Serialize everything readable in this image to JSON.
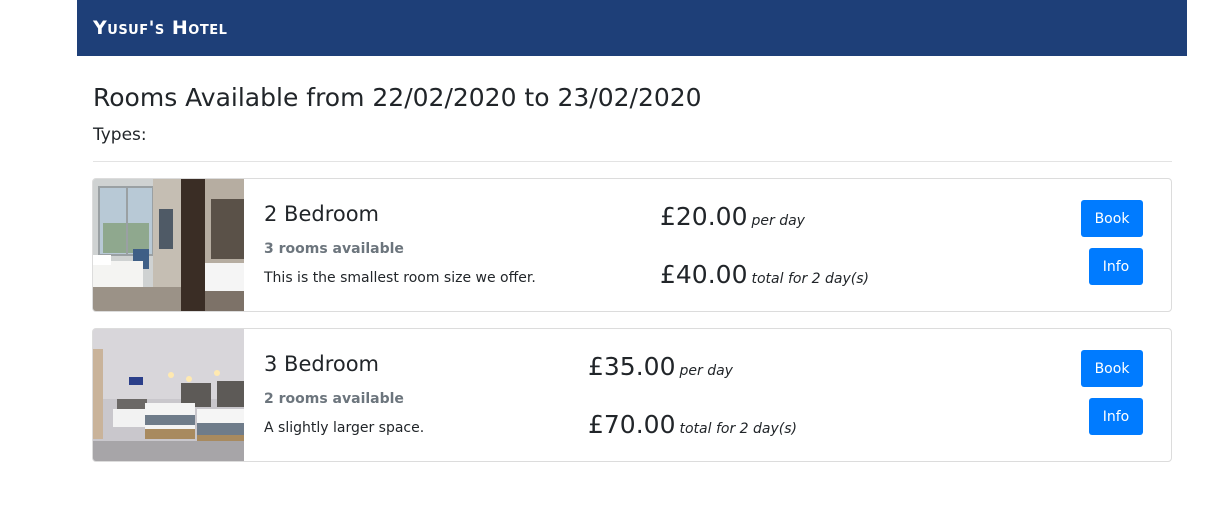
{
  "header": {
    "brand": "Yusuf's Hotel"
  },
  "main": {
    "title": "Rooms Available from 22/02/2020 to 23/02/2020",
    "types_label": "Types:"
  },
  "rooms": [
    {
      "name": "2 Bedroom",
      "availability": "3 rooms available",
      "description": "This is the smallest room size we offer.",
      "price_per_day": "£20.00",
      "per_day_label": "per day",
      "total_price": "£40.00",
      "total_label": "total for 2 day(s)",
      "book_label": "Book",
      "info_label": "Info"
    },
    {
      "name": "3 Bedroom",
      "availability": "2 rooms available",
      "description": "A slightly larger space.",
      "price_per_day": "£35.00",
      "per_day_label": "per day",
      "total_price": "£70.00",
      "total_label": "total for 2 day(s)",
      "book_label": "Book",
      "info_label": "Info"
    }
  ],
  "colors": {
    "navbar": "#1e3f78",
    "primary_button": "#007bff",
    "muted_text": "#6c757d"
  }
}
